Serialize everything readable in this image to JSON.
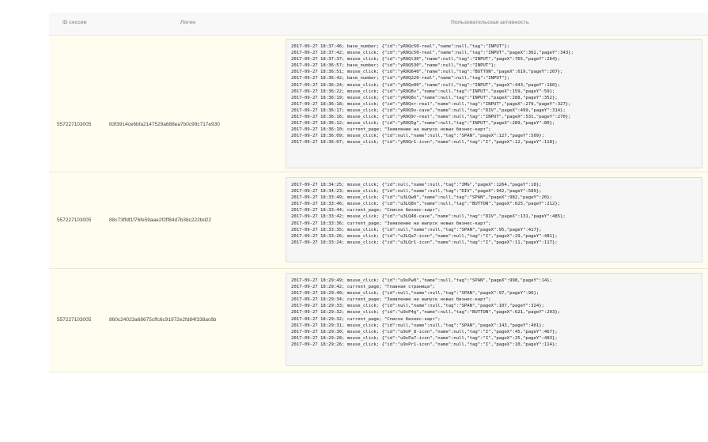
{
  "table": {
    "headers": {
      "session_id": "ID сессии",
      "login": "Логин",
      "activity": "Пользовательская активность"
    },
    "rows": [
      {
        "session_id": "557227103005",
        "login": "83f3914ce6bfa2147529a688ea7b0c99c717e930",
        "log": [
          "2017-09-27 18:37:46; base_number; {\"id\":\"yR9Qc50-real\",\"name\":null,\"tag\":\"INPUT\"};",
          "2017-09-27 18:37:42; mouse_click; {\"id\":\"yR9Qc50-real\",\"name\":null,\"tag\":\"INPUT\",\"pageX\":362,\"pageY\":343};",
          "2017-09-27 18:37:37; mouse_click; {\"id\":\"yR9Ql30\",\"name\":null,\"tag\":\"INPUT\",\"pageX\":765,\"pageY\":264};",
          "2017-09-27 18:36:57; base_number; {\"id\":\"yR9Q530\",\"name\":null,\"tag\":\"INPUT\"};",
          "2017-09-27 18:36:51; mouse_click; {\"id\":\"yR9Q640\",\"name\":null,\"tag\":\"BUTTON\",\"pageX\":619,\"pageY\":207};",
          "2017-09-27 18:36:42; base_number; {\"id\":\"yR9Q220-real\",\"name\":null,\"tag\":\"INPUT\"};",
          "2017-09-27 18:36:24; mouse_click; {\"id\":\"yR9Qo00\",\"name\":null,\"tag\":\"INPUT\",\"pageX\":443,\"pageY\":160};",
          "2017-09-27 18:36:22; mouse_click; {\"id\":\"yR9Q8v\",\"name\":null,\"tag\":\"INPUT\",\"pageX\":159,\"pageY\":59};",
          "2017-09-27 18:36:19; mouse_click; {\"id\":\"yR9Q8s\",\"name\":null,\"tag\":\"INPUT\",\"pageX\":288,\"pageY\":352};",
          "2017-09-27 18:36:18; mouse_click; {\"id\":\"yR9Qxr-real\",\"name\":null,\"tag\":\"INPUT\",\"pageX\":279,\"pageY\":327};",
          "2017-09-27 18:36:17; mouse_click; {\"id\":\"yR9Q9v-cave\",\"name\":null,\"tag\":\"DIV\",\"pageX\":499,\"pageY\":314};",
          "2017-09-27 18:36:16; mouse_click; {\"id\":\"yR9Q9r-real\",\"name\":null,\"tag\":\"INPUT\",\"pageX\":531,\"pageY\":270};",
          "2017-09-27 18:36:12; mouse_click; {\"id\":\"yR9Q5g\",\"name\":null,\"tag\":\"INPUT\",\"pageX\":289,\"pageY\":80};",
          "2017-09-27 18:36:10; current_page; \"Заявление на выпуск новых бизнес-карт\";",
          "2017-09-27 18:36:09; mouse_click; {\"id\":null,\"name\":null,\"tag\":\"SPAN\",\"pageX\":127,\"pageY\":509};",
          "2017-09-27 18:36:07; mouse_click; {\"id\":\"yR9Qr1-icon\",\"name\":null,\"tag\":\"I\",\"pageX\":12,\"pageY\":118};"
        ]
      },
      {
        "session_id": "557227103005",
        "login": "88c73ffdf1f76fe59aae2f2ff84d7b38c222bd22",
        "log": [
          "2017-09-27 18:34:25; mouse_click; {\"id\":null,\"name\":null,\"tag\":\"IMG\",\"pageX\":1264,\"pageY\":18};",
          "2017-09-27 18:34:23; mouse_click; {\"id\":null,\"name\":null,\"tag\":\"DIV\",\"pageX\":942,\"pageY\":589};",
          "2017-09-27 18:33:49; mouse_click; {\"id\":\"u3LQw0\",\"name\":null,\"tag\":\"SPAN\",\"pageX\":982,\"pageY\":20};",
          "2017-09-27 18:33:46; mouse_click; {\"id\":\"u3LQ8n\",\"name\":null,\"tag\":\"BUTTON\",\"pageX\":625,\"pageY\":212};",
          "2017-09-27 18:33:44; current_page; \"Список бизнес-карт\";",
          "2017-09-27 18:33:42; mouse_click; {\"id\":\"u3LQ48-cave\",\"name\":null,\"tag\":\"DIV\",\"pageX\":131,\"pageY\":485};",
          "2017-09-27 18:33:36; current_page; \"Заявление на выпуск новых бизнес-карт\";",
          "2017-09-27 18:33:35; mouse_click; {\"id\":null,\"name\":null,\"tag\":\"SPAN\",\"pageX\":95,\"pageY\":417};",
          "2017-09-27 18:33:26; mouse_click; {\"id\":\"u3LQa7-icon\",\"name\":null,\"tag\":\"I\",\"pageX\":29,\"pageY\":481};",
          "2017-09-27 18:33:24; mouse_click; {\"id\":\"u3LQr1-icon\",\"name\":null,\"tag\":\"I\",\"pageX\":11,\"pageY\":117};"
        ]
      },
      {
        "session_id": "557227103005",
        "login": "860c24023a68675cffc6c91972e2fd84f338ac6b",
        "log": [
          "2017-09-27 18:29:49; mouse_click; {\"id\":\"u9xPw0\",\"name\":null,\"tag\":\"SPAN\",\"pageX\":998,\"pageY\":14};",
          "2017-09-27 18:29:42; current_page; \"Главная страница\";",
          "2017-09-27 18:29:40; mouse_click; {\"id\":null,\"name\":null,\"tag\":\"SPAN\",\"pageX\":97,\"pageY\":96};",
          "2017-09-27 18:29:34; current_page; \"Заявление на выпуск новых бизнес-карт\";",
          "2017-09-27 18:29:33; mouse_click; {\"id\":null,\"name\":null,\"tag\":\"SPAN\",\"pageX\":107,\"pageY\":324};",
          "2017-09-27 18:29:32; mouse_click; {\"id\":\"u9xP4g\",\"name\":null,\"tag\":\"BUTTON\",\"pageX\":621,\"pageY\":203};",
          "2017-09-27 18:29:32; current_page; \"Список бизнес-карт\";",
          "2017-09-27 18:29:31; mouse_click; {\"id\":null,\"name\":null,\"tag\":\"SPAN\",\"pageX\":143,\"pageY\":401};",
          "2017-09-27 18:29:30; mouse_click; {\"id\":\"u9xP_8-icon\",\"name\":null,\"tag\":\"I\",\"pageX\":45,\"pageY\":467};",
          "2017-09-27 18:29:28; mouse_click; {\"id\":\"u9xPa7-icon\",\"name\":null,\"tag\":\"I\",\"pageX\":25,\"pageY\":483};",
          "2017-09-27 18:29:26; mouse_click; {\"id\":\"u9xPr1-icon\",\"name\":null,\"tag\":\"I\",\"pageX\":10,\"pageY\":114};"
        ]
      }
    ]
  }
}
